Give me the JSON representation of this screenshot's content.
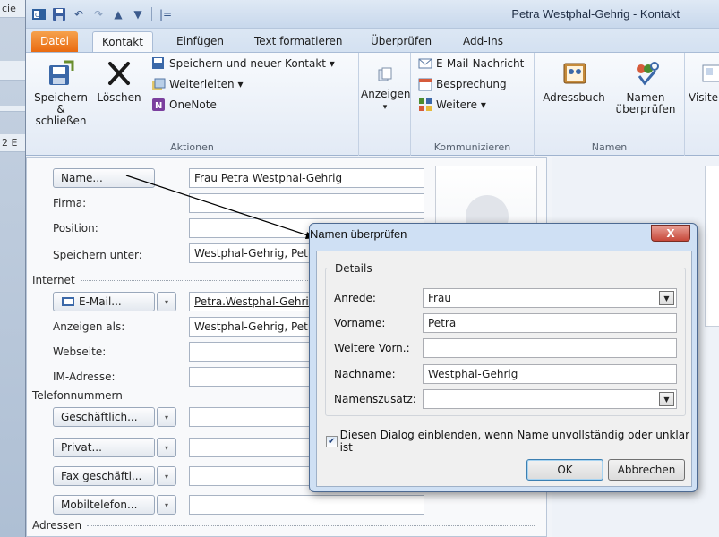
{
  "left_strip": [
    "cie",
    "",
    "",
    "2 E"
  ],
  "title": "Petra Westphal-Gehrig  -  Kontakt",
  "quick_access": [
    {
      "icon": "outlook-icon"
    },
    {
      "icon": "save-icon"
    },
    {
      "icon": "undo-icon"
    },
    {
      "icon": "redo-icon"
    },
    {
      "icon": "up-arrow-icon"
    },
    {
      "icon": "down-arrow-icon"
    },
    {
      "icon": "customize-qat-icon",
      "label": "|="
    }
  ],
  "tabs": [
    "Datei",
    "Kontakt",
    "Einfügen",
    "Text formatieren",
    "Überprüfen",
    "Add-Ins"
  ],
  "ribbon": {
    "aktionen": {
      "label": "Aktionen",
      "save_close": "Speichern\n& schließen",
      "delete": "Löschen",
      "save_new": "Speichern und neuer Kontakt ▾",
      "forward": "Weiterleiten ▾",
      "onenote": "OneNote"
    },
    "anzeigen": {
      "label": "Anzeigen",
      "arrow": "▾"
    },
    "kommunizieren": {
      "label": "Kommunizieren",
      "email": "E-Mail-Nachricht",
      "meeting": "Besprechung",
      "more": "Weitere ▾"
    },
    "namen": {
      "label": "Namen",
      "addressbook": "Adressbuch",
      "check_names": "Namen\nüberprüfen"
    },
    "visit": "Visite"
  },
  "form": {
    "name_button": "Name...",
    "name_value": "Frau Petra Westphal-Gehrig",
    "company_label": "Firma:",
    "position_label": "Position:",
    "save_as_label": "Speichern unter:",
    "save_as_value": "Westphal-Gehrig, Petr",
    "internet_section": "Internet",
    "email_button": "E-Mail...",
    "email_value": "Petra.Westphal-Gehrig",
    "display_as_label": "Anzeigen als:",
    "display_as_value": "Westphal-Gehrig, Petr",
    "website_label": "Webseite:",
    "im_label": "IM-Adresse:",
    "phone_section": "Telefonnummern",
    "phone_buttons": [
      "Geschäftlich...",
      "Privat...",
      "Fax geschäftl...",
      "Mobiltelefon..."
    ],
    "address_section": "Adressen"
  },
  "dialog": {
    "title": "Namen überprüfen",
    "close": "X",
    "group_title": "Details",
    "salutation_label": "Anrede:",
    "salutation_value": "Frau",
    "firstname_label": "Vorname:",
    "firstname_value": "Petra",
    "middlename_label": "Weitere Vorn.:",
    "middlename_value": "",
    "lastname_label": "Nachname:",
    "lastname_value": "Westphal-Gehrig",
    "suffix_label": "Namenszusatz:",
    "suffix_value": "",
    "checkbox_label": "Diesen Dialog einblenden, wenn Name unvollständig oder unklar ist",
    "checkbox_checked": true,
    "ok": "OK",
    "cancel": "Abbrechen"
  }
}
